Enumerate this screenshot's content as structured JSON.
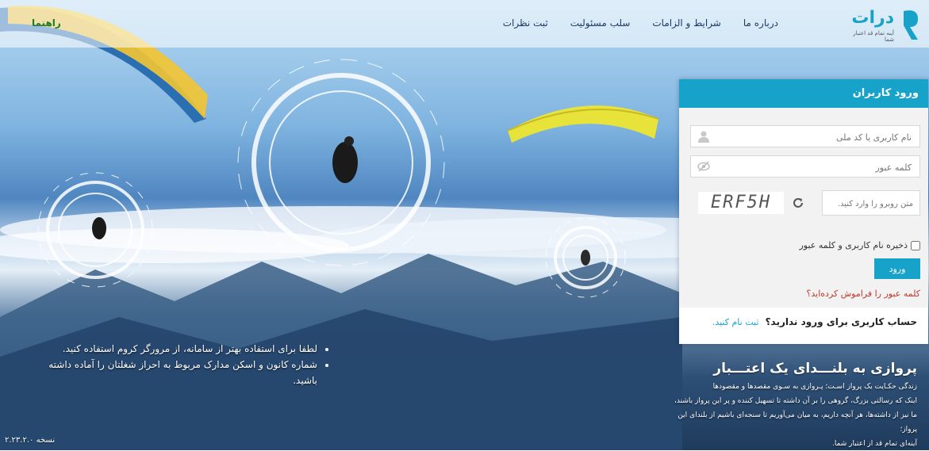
{
  "header": {
    "logo_name": "درات",
    "logo_tagline": "آینه تمام قد اعتبار شما",
    "nav": [
      "درباره ما",
      "شرایط و الزامات",
      "سلب مسئولیت",
      "ثبت نظرات"
    ],
    "help": "راهنما"
  },
  "login": {
    "title": "ورود کاربران",
    "username_placeholder": "نام کاربری یا کد ملی",
    "password_placeholder": "کلمه عبور",
    "captcha_placeholder": "متن روبرو را وارد کنید.",
    "captcha_text": "ERF5H",
    "remember_label": "ذخیره نام کاربری و کلمه عبور",
    "submit_label": "ورود",
    "forgot_label": "کلمه عبور را فراموش کرده‌اید؟",
    "signup_question": "حساب کاربری برای ورود ندارید؟",
    "signup_link": "ثبت نام کنید."
  },
  "slogan": {
    "title": "پروازی به بلنـــدای یک اعتـــبار",
    "lines": [
      "زندگی حکـایت یک پرواز اسـت؛ پـروازی به سـوی مقصدها و مقصودها",
      "اینک که رسالتی بزرگ، گروهی را بر آن داشته تا تسهیل کننده و پر این پرواز باشند،",
      "ما نیز از داشته‌ها، هر آنچه داریم، به میان می‌آوریم تا سنجه‌ای باشیم از بلندای این پرواز؛",
      "آینه‌ای تمام قد از اعتبار شما."
    ]
  },
  "tips": [
    "لطفا برای استفاده بهتر از سامانه، از مرورگر کروم استفاده کنید.",
    "شماره کانون و اسکن مدارک مربوط به احراز شغلتان را آماده داشته باشید."
  ],
  "version": "نسخه ۲.۲۳.۲.۰",
  "colors": {
    "accent": "#17a2c9",
    "forgot": "#c0392b",
    "help": "#1f7a2a"
  }
}
